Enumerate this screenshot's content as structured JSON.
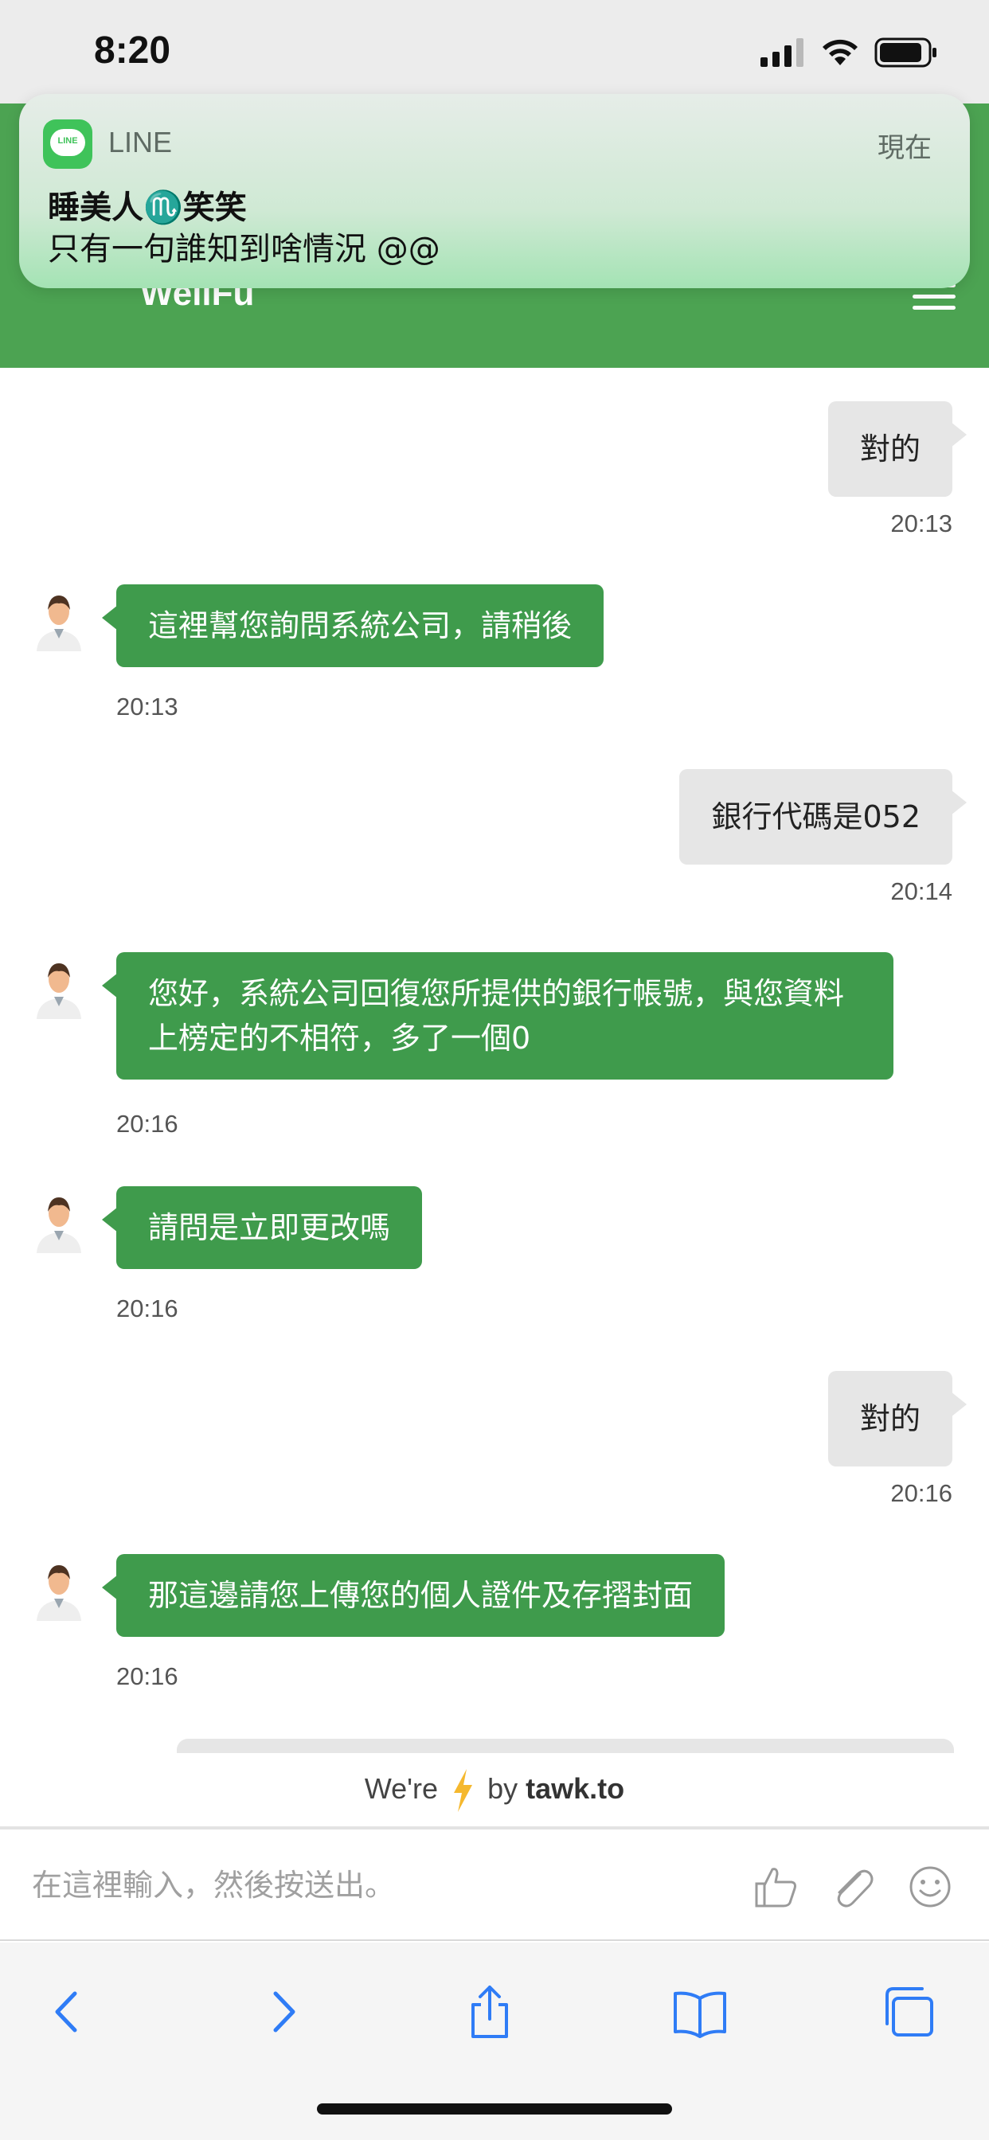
{
  "status_bar": {
    "time": "8:20"
  },
  "notification": {
    "app_name": "LINE",
    "app_icon_text": "LINE",
    "time": "現在",
    "sender": "睡美人♏️笑笑",
    "message": "只有一句誰知到啥情況 @@"
  },
  "header": {
    "title": "WellFu"
  },
  "messages": [
    {
      "side": "out",
      "text": "對的",
      "time": "20:13"
    },
    {
      "side": "in",
      "text": "這裡幫您詢問系統公司，請稍後",
      "time": "20:13"
    },
    {
      "side": "out",
      "text": "銀行代碼是052",
      "time": "20:14"
    },
    {
      "side": "in",
      "text": "您好，系統公司回復您所提供的銀行帳號，與您資料上榜定的不相符，多了一個0",
      "time": "20:16"
    },
    {
      "side": "in",
      "text": "請問是立即更改嗎",
      "time": "20:16"
    },
    {
      "side": "out",
      "text": "對的",
      "time": "20:16"
    },
    {
      "side": "in",
      "text": "那這邊請您上傳您的個人證件及存摺封面",
      "time": "20:16"
    }
  ],
  "branding": {
    "prefix": "We're",
    "suffix": "by",
    "brand": "tawk.to"
  },
  "composer": {
    "placeholder": "在這裡輸入，然後按送出。"
  },
  "colors": {
    "header_green": "#4ca352",
    "bubble_green": "#3f9b4c",
    "bubble_gray": "#e6e6e6",
    "ios_blue": "#2f7cf6"
  },
  "icons": {
    "composer": [
      "thumbs-up-icon",
      "paperclip-icon",
      "emoji-icon"
    ],
    "toolbar": [
      "back-icon",
      "forward-icon",
      "share-icon",
      "bookmarks-icon",
      "tabs-icon"
    ]
  }
}
